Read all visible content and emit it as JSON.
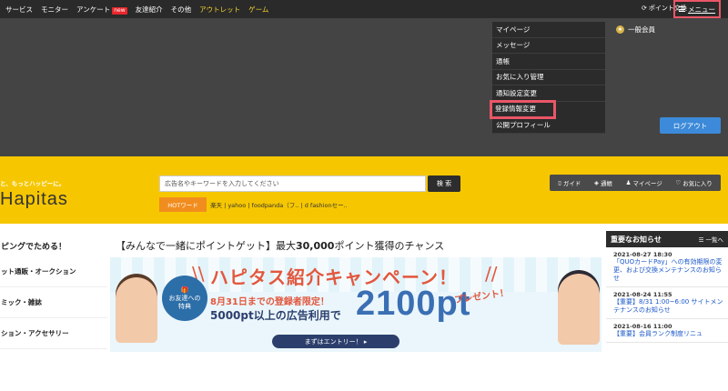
{
  "nav": {
    "links": [
      "サービス",
      "モニター",
      "アンケート",
      "友達紹介",
      "その他",
      "アウトレット",
      "ゲーム"
    ],
    "new_badge": "new",
    "point_exchange": "ポイント交換",
    "menu_label": "メニュー"
  },
  "dropdown": {
    "items": [
      "マイページ",
      "メッセージ",
      "通帳",
      "お気に入り管理",
      "通知設定変更",
      "登録情報変更",
      "公開プロフィール"
    ],
    "highlighted_index": 5
  },
  "account": {
    "member_type": "一般会員",
    "logout_label": "ログアウト"
  },
  "header": {
    "tagline": "と、もっとハッピーに。",
    "logo_text": "Hapitas",
    "search_placeholder": "広告名やキーワードを入力してください",
    "search_button": "検 索",
    "hot_label": "HOTワード",
    "hot_words": "楽天 | yahoo | foodpanda（フ.. | d fashionセー..",
    "utility": [
      "ガイド",
      "通帳",
      "マイページ",
      "お気に入り"
    ]
  },
  "sidebar": {
    "heading": "ピングでためる！",
    "categories": [
      "ット通販・オークション",
      "ミック・雑誌",
      "ション・アクセサリー"
    ]
  },
  "campaign": {
    "title_prefix": "【みんなで一緒にポイントゲット】最大",
    "title_strong": "30,000",
    "title_suffix": "ポイント獲得のチャンス",
    "banner_heading": "ハピタス紹介キャンペーン！",
    "friend_line1": "お友達への",
    "friend_line2": "特典",
    "limit_text": "8月31日までの登録者限定！",
    "condition_text": "5000pt以上の広告利用で",
    "big_points": "2100pt",
    "present_text": "プレゼント！",
    "entry_button": "まずはエントリー！ ▸"
  },
  "news": {
    "title": "重要なお知らせ",
    "all_link": "一覧へ",
    "entries": [
      {
        "date": "2021-08-27 18:30",
        "text": "「QUOカードPay」への有効期限の変更、および交換メンテナンスのお知らせ"
      },
      {
        "date": "2021-08-24 11:55",
        "text": "【重要】8/31 1:00~6:00 サイトメンテナンスのお知らせ"
      },
      {
        "date": "2021-08-16 11:00",
        "text": "【重要】会員ランク制度リニュ"
      }
    ]
  },
  "colors": {
    "brand_yellow": "#f6c700",
    "highlight_red": "#ea5667",
    "logout_blue": "#3c8ad9",
    "hot_orange": "#f18d1f",
    "news_link_blue": "#1a57c9"
  }
}
